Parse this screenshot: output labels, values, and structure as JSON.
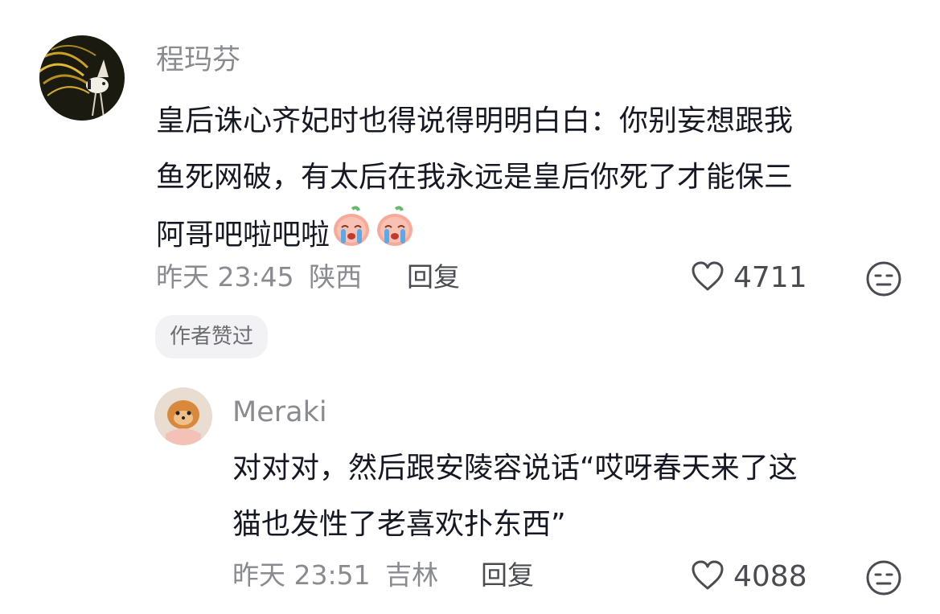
{
  "comments": [
    {
      "username": "程玛芬",
      "body_lines": [
        "皇后诛心齐妃时也得说得明明白白：你别妄想跟我",
        "鱼死网破，有太后在我永远是皇后你死了才能保三",
        "阿哥吧啦吧啦"
      ],
      "emojis": [
        "crying-emoji",
        "crying-emoji"
      ],
      "time": "昨天 23:45",
      "location": "陕西",
      "reply_label": "回复",
      "like_count": "4711",
      "badge": "作者赞过"
    },
    {
      "username": "Meraki",
      "body_lines": [
        "对对对，然后跟安陵容说话“哎呀春天来了这",
        "猫也发性了老喜欢扑东西”"
      ],
      "time": "昨天 23:51",
      "location": "吉林",
      "reply_label": "回复",
      "like_count": "4088"
    }
  ],
  "colors": {
    "primary_text": "#161823",
    "secondary_text": "#8a8b91",
    "badge_bg": "#f2f2f4"
  }
}
